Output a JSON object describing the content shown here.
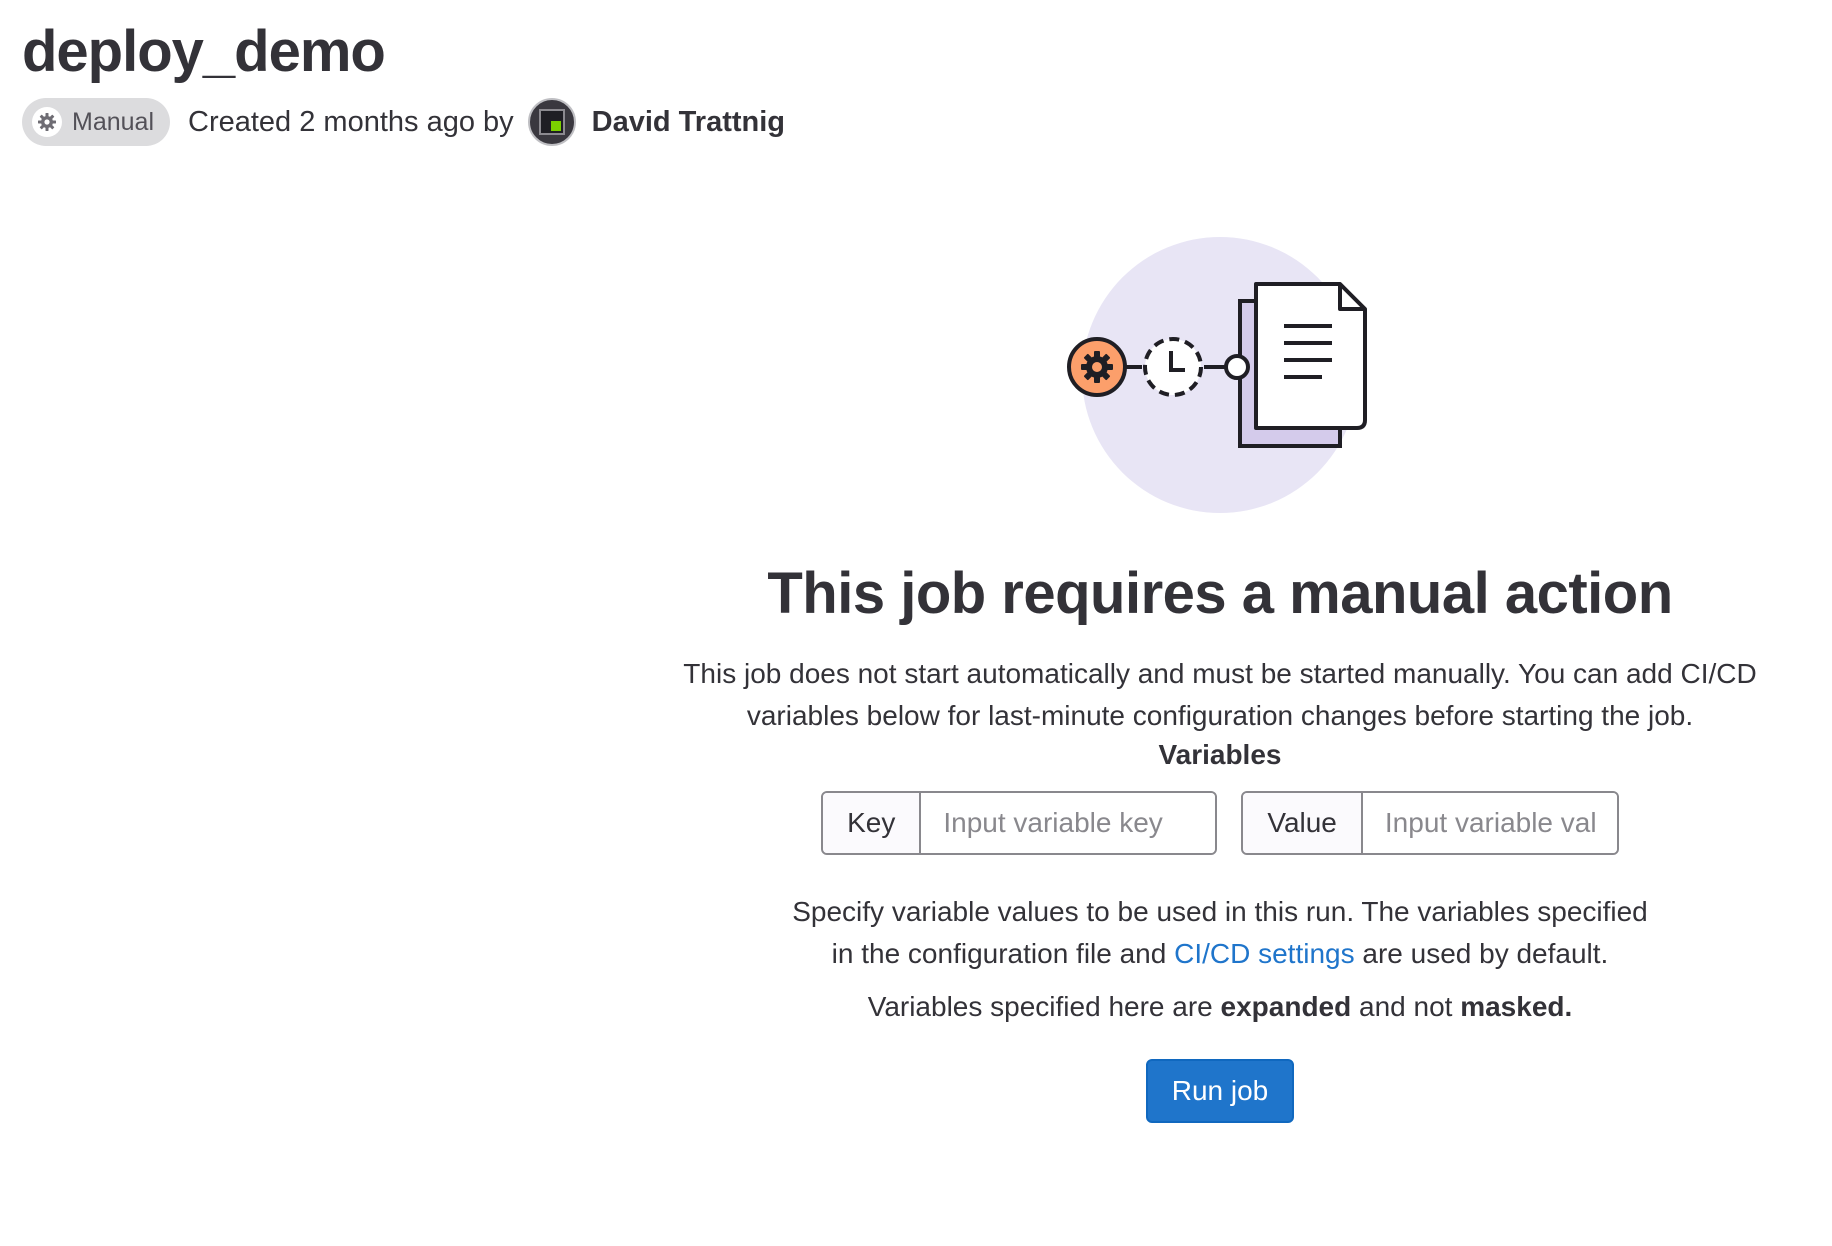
{
  "header": {
    "title": "deploy_demo",
    "status_badge": "Manual",
    "created_text": "Created 2 months ago by",
    "author": "David Trattnig"
  },
  "empty_state": {
    "title": "This job requires a manual action",
    "description": "This job does not start automatically and must be started manually. You can add CI/CD variables below for last-minute configuration changes before starting the job.",
    "variables_label": "Variables",
    "key_addon": "Key",
    "key_placeholder": "Input variable key",
    "value_addon": "Value",
    "value_placeholder": "Input variable value",
    "help_before": "Specify variable values to be used in this run. The variables specified in the configuration file and ",
    "help_link": "CI/CD settings",
    "help_after": " are used by default.",
    "note_prefix": "Variables specified here are ",
    "note_bold1": "expanded",
    "note_middle": " and not ",
    "note_bold2": "masked.",
    "run_button": "Run job"
  },
  "colors": {
    "primary": "#1f75cb",
    "illustration_bg": "#e8e5f5",
    "gear_orange": "#fc9f6b",
    "doc_back": "#d4cbeb"
  },
  "icons": {
    "status": "gear-icon",
    "illustration": "manual-job-illustration"
  }
}
